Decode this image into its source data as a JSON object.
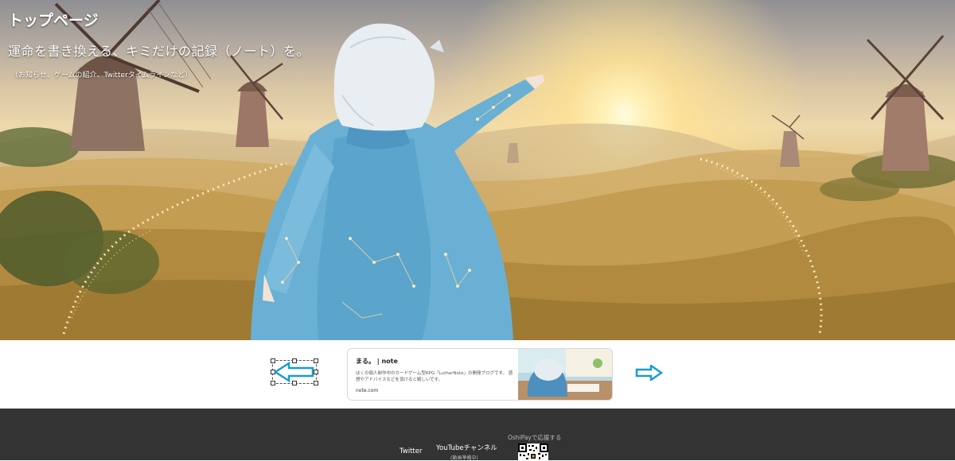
{
  "hero": {
    "title": "トップページ",
    "tagline": "運命を書き換える、キミだけの記録（ノート）を。",
    "subtitle": "（お知らせ、ゲームの紹介、Twitterタイムラインなど）"
  },
  "carousel": {
    "prev_icon": "arrow-left-icon",
    "next_icon": "arrow-right-icon",
    "card": {
      "title": "まる。 | note",
      "description": "ぼくの個人制作中のカードゲーム型RPG「LutherNote」の開発ブログです。 感想やアドバイスなどを頂けると嬉しいです。",
      "domain": "note.com"
    }
  },
  "footer": {
    "twitter": "Twitter",
    "youtube": "YouTubeチャンネル",
    "youtube_note": "(動画準備中)",
    "oshipay_label": "OshiPayで応援する"
  },
  "colors": {
    "accent_arrow": "#1a9bd7",
    "footer_bg": "#333333"
  }
}
